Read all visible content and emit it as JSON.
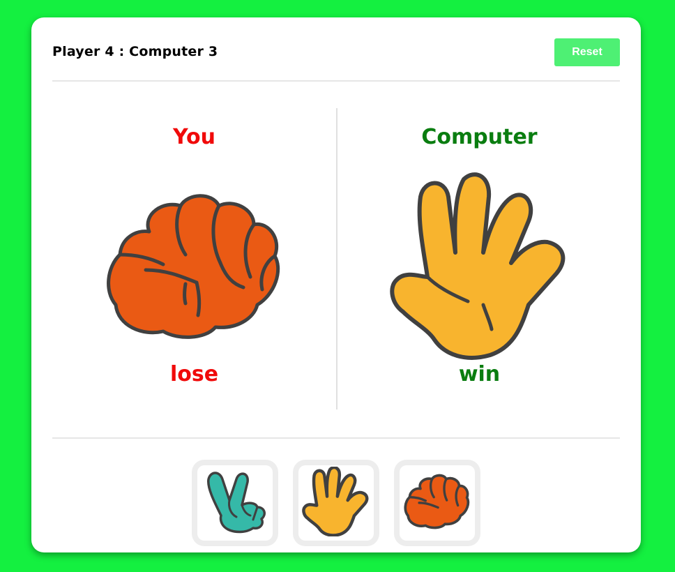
{
  "header": {
    "score_text": "Player 4 : Computer 3",
    "reset_label": "Reset"
  },
  "player": {
    "title": "You",
    "choice_icon": "rock-fist-icon",
    "result": "lose"
  },
  "computer": {
    "title": "Computer",
    "choice_icon": "paper-hand-icon",
    "result": "win"
  },
  "choices": [
    {
      "name": "scissors",
      "icon": "scissors-hand-icon"
    },
    {
      "name": "paper",
      "icon": "paper-hand-icon"
    },
    {
      "name": "rock",
      "icon": "rock-fist-icon"
    }
  ],
  "colors": {
    "background": "#14f040",
    "reset_button": "#4ef074",
    "lose": "#f00a0a",
    "win": "#0a7d10",
    "rock": "#ea5a14",
    "paper": "#f8b42e",
    "scissors": "#35b9a8",
    "outline": "#404040"
  }
}
